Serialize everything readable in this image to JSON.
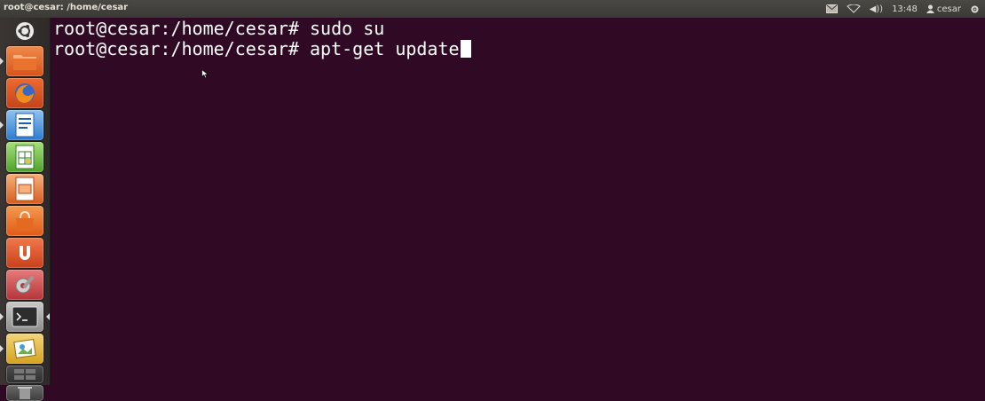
{
  "window": {
    "title": "root@cesar: /home/cesar"
  },
  "indicators": {
    "mail_icon": "envelope-icon",
    "network_icon": "wifi-icon",
    "volume_text": "◀))",
    "clock": "13:48",
    "user": "cesar",
    "session_icon": "gear-icon"
  },
  "launcher": {
    "items": [
      {
        "name": "dash-home",
        "icon": "ubuntu-logo-icon"
      },
      {
        "name": "files",
        "icon": "folder-icon"
      },
      {
        "name": "firefox",
        "icon": "firefox-icon"
      },
      {
        "name": "writer",
        "icon": "document-icon"
      },
      {
        "name": "calc",
        "icon": "spreadsheet-icon"
      },
      {
        "name": "impress",
        "icon": "presentation-icon"
      },
      {
        "name": "software-center",
        "icon": "shopping-bag-icon"
      },
      {
        "name": "ubuntu-one",
        "icon": "ubuntu-one-icon"
      },
      {
        "name": "settings",
        "icon": "settings-icon"
      },
      {
        "name": "terminal",
        "icon": "terminal-icon"
      },
      {
        "name": "image-viewer",
        "icon": "photos-icon"
      },
      {
        "name": "workspaces",
        "icon": "workspace-switcher-icon"
      },
      {
        "name": "trash",
        "icon": "trash-icon"
      }
    ]
  },
  "terminal": {
    "lines": [
      "root@cesar:/home/cesar# sudo su",
      "root@cesar:/home/cesar# apt-get update"
    ]
  },
  "colors": {
    "terminal_bg": "#300a24",
    "terminal_fg": "#ffffff",
    "panel_bg": "#3c3b37"
  }
}
